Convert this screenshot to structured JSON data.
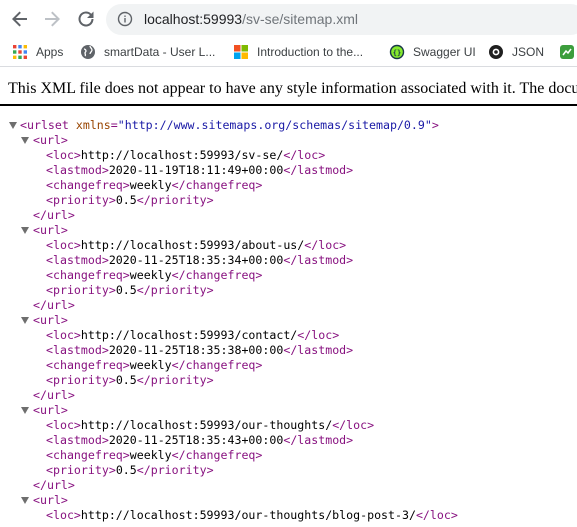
{
  "browser": {
    "url_host": "localhost:59993",
    "url_path": "/sv-se/sitemap.xml"
  },
  "bookmarks": [
    {
      "label": "Apps",
      "icon": "apps-grid-icon"
    },
    {
      "label": "smartData - User L...",
      "icon": "globe-icon"
    },
    {
      "label": "Introduction to the...",
      "icon": "microsoft-logo-icon"
    },
    {
      "label": "Swagger UI",
      "icon": "swagger-icon"
    },
    {
      "label": "JSON",
      "icon": "json-icon"
    }
  ],
  "xml_notice": "This XML file does not appear to have any style information associated with it. The document tree is shown below.",
  "urlset": {
    "open_tag": "<urlset",
    "attr_name": "xmlns",
    "attr_value": "\"http://www.sitemaps.org/schemas/sitemap/0.9\"",
    "open_end": ">"
  },
  "tags": {
    "url_open": "<url>",
    "url_close": "</url>",
    "loc_open": "<loc>",
    "loc_close": "</loc>",
    "lastmod_open": "<lastmod>",
    "lastmod_close": "</lastmod>",
    "changefreq_open": "<changefreq>",
    "changefreq_close": "</changefreq>",
    "priority_open": "<priority>",
    "priority_close": "</priority>"
  },
  "urls": [
    {
      "loc": "http://localhost:59993/sv-se/",
      "lastmod": "2020-11-19T18:11:49+00:00",
      "changefreq": "weekly",
      "priority": "0.5"
    },
    {
      "loc": "http://localhost:59993/about-us/",
      "lastmod": "2020-11-25T18:35:34+00:00",
      "changefreq": "weekly",
      "priority": "0.5"
    },
    {
      "loc": "http://localhost:59993/contact/",
      "lastmod": "2020-11-25T18:35:38+00:00",
      "changefreq": "weekly",
      "priority": "0.5"
    },
    {
      "loc": "http://localhost:59993/our-thoughts/",
      "lastmod": "2020-11-25T18:35:43+00:00",
      "changefreq": "weekly",
      "priority": "0.5"
    },
    {
      "loc": "http://localhost:59993/our-thoughts/blog-post-3/"
    }
  ]
}
